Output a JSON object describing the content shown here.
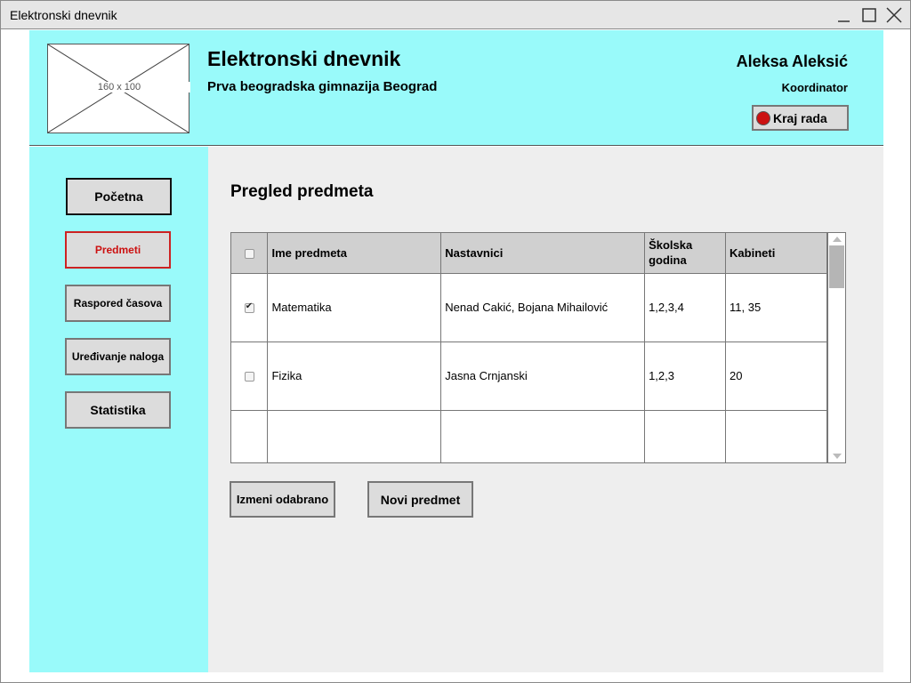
{
  "window": {
    "title": "Elektronski dnevnik"
  },
  "header": {
    "logo_placeholder": "160 x 100",
    "app_title": "Elektronski dnevnik",
    "school": "Prva beogradska gimnazija Beograd",
    "user_name": "Aleksa Aleksić",
    "user_role": "Koordinator",
    "logout_label": "Kraj rada"
  },
  "sidebar": {
    "items": [
      {
        "label": "Početna"
      },
      {
        "label": "Predmeti",
        "active": true
      },
      {
        "label": "Raspored časova"
      },
      {
        "label": "Uređivanje naloga"
      },
      {
        "label": "Statistika"
      }
    ]
  },
  "main": {
    "title": "Pregled predmeta",
    "table": {
      "columns": [
        "Ime predmeta",
        "Nastavnici",
        "Školska godina",
        "Kabineti"
      ],
      "rows": [
        {
          "checked": true,
          "cells": [
            "Matematika",
            "Nenad Cakić, Bojana Mihailović",
            "1,2,3,4",
            "11, 35"
          ]
        },
        {
          "checked": false,
          "cells": [
            "Fizika",
            "Jasna Crnjanski",
            "1,2,3",
            "20"
          ]
        }
      ]
    },
    "edit_button": "Izmeni odabrano",
    "new_button": "Novi predmet"
  },
  "colors": {
    "accent": "#99fafa",
    "content_bg": "#eeeeee",
    "active_nav": "#cc1111"
  }
}
